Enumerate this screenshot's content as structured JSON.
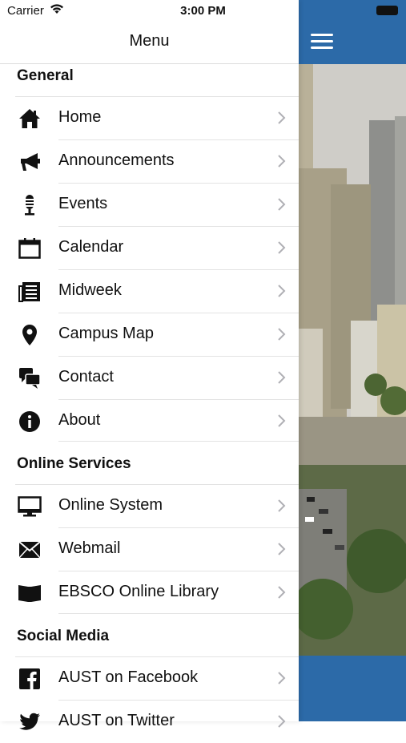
{
  "status_bar": {
    "carrier": "Carrier",
    "time": "3:00 PM"
  },
  "drawer": {
    "title": "Menu"
  },
  "sections": [
    {
      "header": "General",
      "items": [
        {
          "label": "Home",
          "icon": "home-icon"
        },
        {
          "label": "Announcements",
          "icon": "megaphone-icon"
        },
        {
          "label": "Events",
          "icon": "microphone-icon"
        },
        {
          "label": "Calendar",
          "icon": "calendar-icon"
        },
        {
          "label": "Midweek",
          "icon": "newspaper-icon"
        },
        {
          "label": "Campus Map",
          "icon": "map-pin-icon"
        },
        {
          "label": "Contact",
          "icon": "chat-bubbles-icon"
        },
        {
          "label": "About",
          "icon": "info-icon"
        }
      ]
    },
    {
      "header": "Online Services",
      "items": [
        {
          "label": "Online System",
          "icon": "monitor-icon"
        },
        {
          "label": "Webmail",
          "icon": "envelope-icon"
        },
        {
          "label": "EBSCO Online Library",
          "icon": "book-icon"
        }
      ]
    },
    {
      "header": "Social Media",
      "items": [
        {
          "label": "AUST on Facebook",
          "icon": "facebook-icon"
        },
        {
          "label": "AUST on Twitter",
          "icon": "twitter-icon"
        }
      ]
    }
  ],
  "colors": {
    "accent": "#2c6aa8",
    "text": "#111111",
    "divider": "#e3e3e3",
    "chevron": "#b0b0b5"
  },
  "content_pane": {
    "menu_button_icon": "hamburger-icon",
    "background_image": "city-aerial-photo"
  }
}
